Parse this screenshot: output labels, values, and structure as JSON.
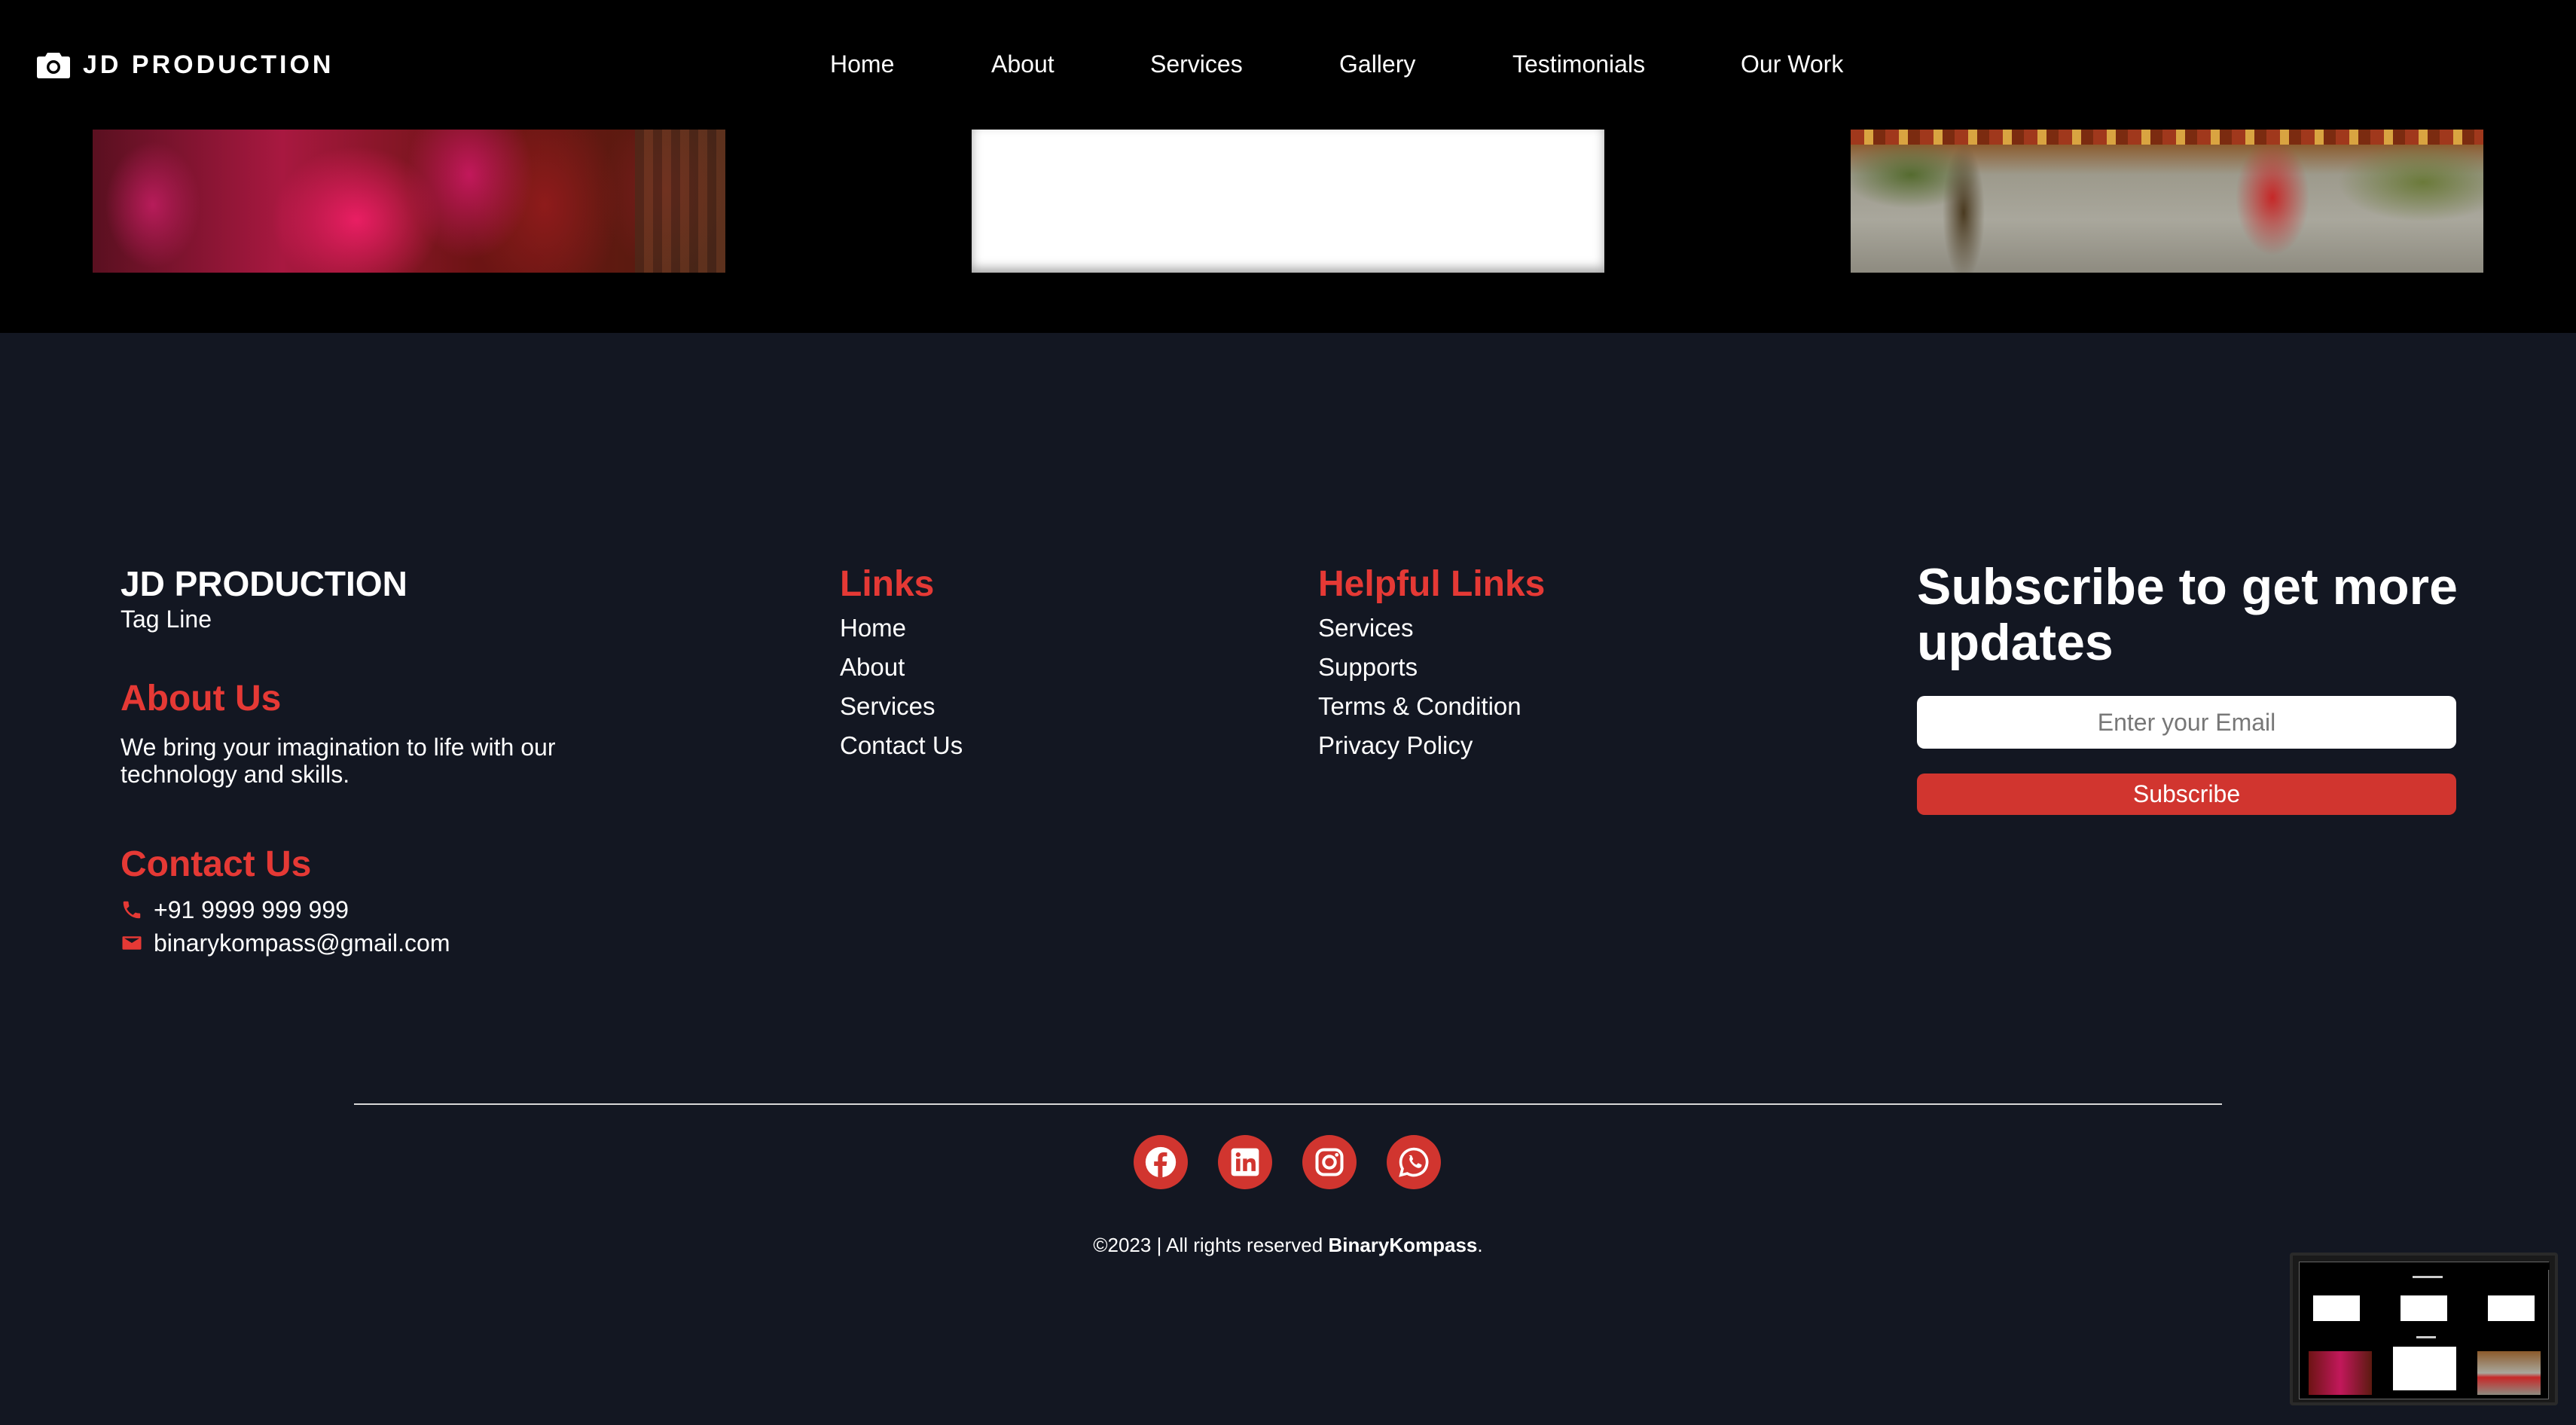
{
  "nav": {
    "brand": "JD PRODUCTION",
    "links": [
      "Home",
      "About",
      "Services",
      "Gallery",
      "Testimonials",
      "Our Work"
    ]
  },
  "footer": {
    "brand_title": "JD PRODUCTION",
    "tagline": "Tag Line",
    "about_title": "About Us",
    "about_text_line1": "We bring your imagination to life with our",
    "about_text_line2": "technology and skills.",
    "contact_title": "Contact Us",
    "phone": "+91 9999 999 999",
    "email": "binarykompass@gmail.com",
    "links_title": "Links",
    "links": [
      "Home",
      "About",
      "Services",
      "Contact Us"
    ],
    "helpful_title": "Helpful Links",
    "helpful_links": [
      "Services",
      "Supports",
      "Terms & Condition",
      "Privacy Policy"
    ],
    "subscribe_title_line1": "Subscribe to get more",
    "subscribe_title_line2": "updates",
    "email_placeholder": "Enter your Email",
    "subscribe_button": "Subscribe",
    "socials": [
      "facebook-icon",
      "linkedin-icon",
      "instagram-icon",
      "whatsapp-icon"
    ],
    "copyright_prefix": "©2023 | All rights reserved ",
    "copyright_brand": "BinaryKompass",
    "copyright_suffix": "."
  },
  "colors": {
    "accent": "#d1352f",
    "heading_red": "#e53935",
    "footer_bg": "#131722",
    "nav_bg": "#000000"
  }
}
